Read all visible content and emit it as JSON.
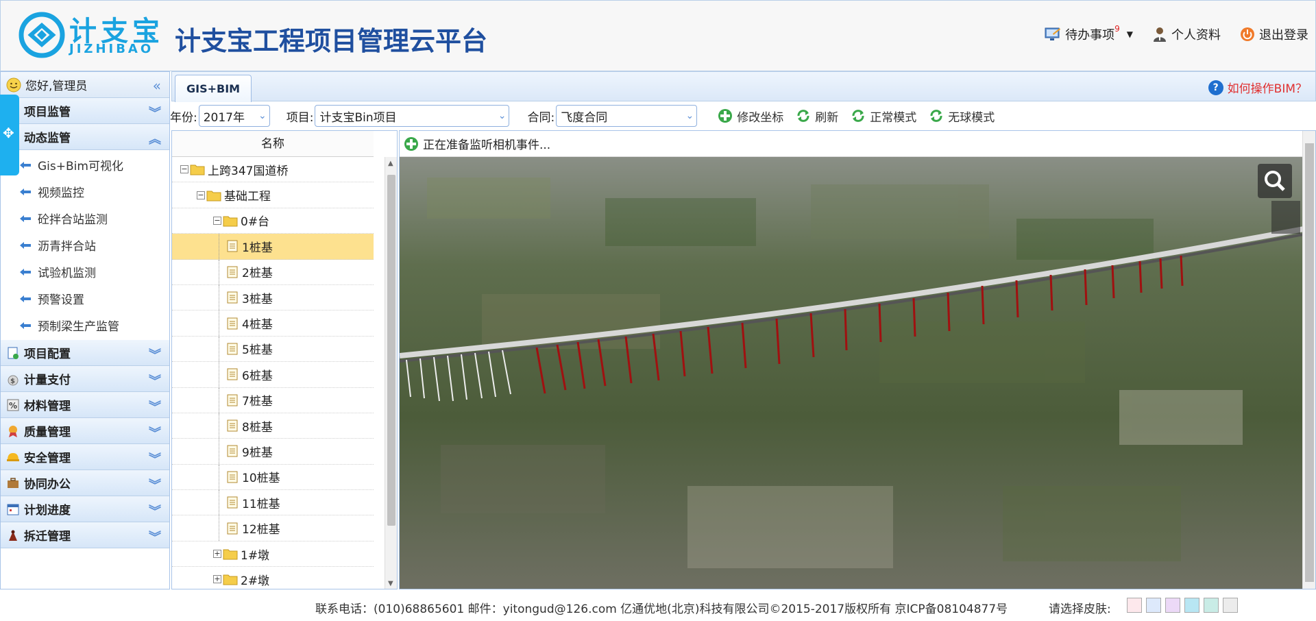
{
  "header": {
    "logo_cn": "计支宝",
    "logo_en": "JIZHIBAO",
    "title": "计支宝工程项目管理云平台",
    "todo_label": "待办事项",
    "todo_count": "9",
    "profile_label": "个人资料",
    "logout_label": "退出登录",
    "logo_color": "#1aa3e0",
    "title_color": "#1f4f9f"
  },
  "sidebar": {
    "greeting": "您好,管理员",
    "groups": [
      {
        "label": "项目监管",
        "icon": "monitor-icon"
      },
      {
        "label": "动态监管",
        "icon": "monitor-icon",
        "expanded": true,
        "items": [
          "Gis+Bim可视化",
          "视频监控",
          "砼拌合站监测",
          "沥青拌合站",
          "试验机监测",
          "预警设置",
          "预制梁生产监管"
        ]
      },
      {
        "label": "项目配置",
        "icon": "config-icon"
      },
      {
        "label": "计量支付",
        "icon": "money-bag-icon"
      },
      {
        "label": "材料管理",
        "icon": "percent-icon"
      },
      {
        "label": "质量管理",
        "icon": "medal-icon"
      },
      {
        "label": "安全管理",
        "icon": "hardhat-icon"
      },
      {
        "label": "协同办公",
        "icon": "briefcase-icon"
      },
      {
        "label": "计划进度",
        "icon": "calendar-icon"
      },
      {
        "label": "拆迁管理",
        "icon": "demolition-icon"
      }
    ]
  },
  "tabs": {
    "active": "GIS+BIM",
    "help": "如何操作BIM？"
  },
  "toolbar": {
    "year_label": "年份:",
    "year_value": "2017年",
    "project_label": "项目:",
    "project_value": "计支宝Bin项目",
    "contract_label": "合同:",
    "contract_value": "飞度合同",
    "btn_edit": "修改坐标",
    "btn_refresh": "刷新",
    "btn_normal": "正常模式",
    "btn_noglobe": "无球模式"
  },
  "tree": {
    "header": "名称",
    "nodes": [
      {
        "label": "上跨347国道桥",
        "level": 0,
        "type": "folder",
        "toggle": "−"
      },
      {
        "label": "基础工程",
        "level": 1,
        "type": "folder",
        "toggle": "−"
      },
      {
        "label": "0#台",
        "level": 2,
        "type": "folder",
        "toggle": "−"
      },
      {
        "label": "1桩基",
        "level": 3,
        "type": "doc",
        "selected": true
      },
      {
        "label": "2桩基",
        "level": 3,
        "type": "doc"
      },
      {
        "label": "3桩基",
        "level": 3,
        "type": "doc"
      },
      {
        "label": "4桩基",
        "level": 3,
        "type": "doc"
      },
      {
        "label": "5桩基",
        "level": 3,
        "type": "doc"
      },
      {
        "label": "6桩基",
        "level": 3,
        "type": "doc"
      },
      {
        "label": "7桩基",
        "level": 3,
        "type": "doc"
      },
      {
        "label": "8桩基",
        "level": 3,
        "type": "doc"
      },
      {
        "label": "9桩基",
        "level": 3,
        "type": "doc"
      },
      {
        "label": "10桩基",
        "level": 3,
        "type": "doc"
      },
      {
        "label": "11桩基",
        "level": 3,
        "type": "doc"
      },
      {
        "label": "12桩基",
        "level": 3,
        "type": "doc"
      },
      {
        "label": "1#墩",
        "level": 2,
        "type": "folder",
        "toggle": "+"
      },
      {
        "label": "2#墩",
        "level": 2,
        "type": "folder",
        "toggle": "+"
      }
    ]
  },
  "map": {
    "status": "正在准备监听相机事件..."
  },
  "footer": {
    "contact": "联系电话：(010)68865601 邮件：yitongud@126.com 亿通优地(北京)科技有限公司©2015-2017版权所有 京ICP备08104877号",
    "skin_label": "请选择皮肤:",
    "skins": [
      "#fde8ec",
      "#dde9fb",
      "#ecd9f7",
      "#b8e6f3",
      "#c9ece6",
      "#ececec"
    ]
  }
}
